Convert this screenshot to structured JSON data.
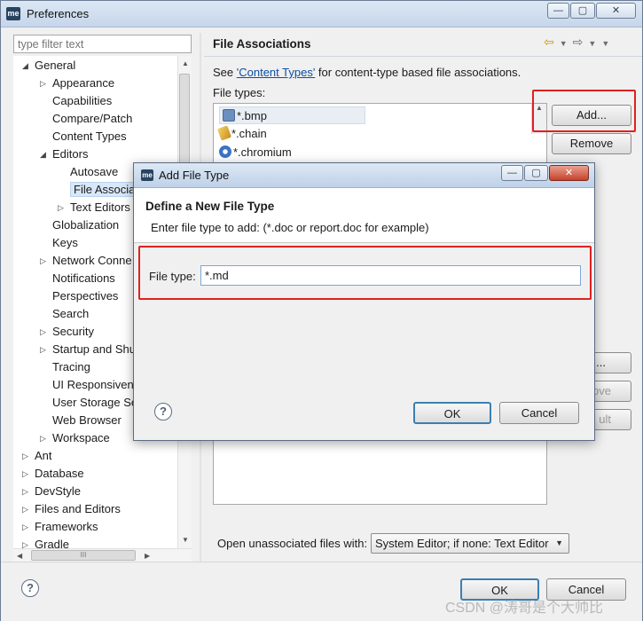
{
  "window": {
    "title": "Preferences",
    "app_icon": "me",
    "controls": {
      "minimize": "—",
      "maximize": "▢",
      "close": "✕"
    }
  },
  "sidebar": {
    "filter_placeholder": "type filter text",
    "tree": [
      {
        "label": "General",
        "level": 0,
        "expanded": true
      },
      {
        "label": "Appearance",
        "level": 1,
        "collapsed": true
      },
      {
        "label": "Capabilities",
        "level": 1
      },
      {
        "label": "Compare/Patch",
        "level": 1
      },
      {
        "label": "Content Types",
        "level": 1
      },
      {
        "label": "Editors",
        "level": 1,
        "expanded": true
      },
      {
        "label": "Autosave",
        "level": 2
      },
      {
        "label": "File Associati",
        "level": 2,
        "selected": true
      },
      {
        "label": "Text Editors",
        "level": 2,
        "collapsed": true
      },
      {
        "label": "Globalization",
        "level": 1
      },
      {
        "label": "Keys",
        "level": 1
      },
      {
        "label": "Network Conne",
        "level": 1,
        "collapsed": true
      },
      {
        "label": "Notifications",
        "level": 1
      },
      {
        "label": "Perspectives",
        "level": 1
      },
      {
        "label": "Search",
        "level": 1
      },
      {
        "label": "Security",
        "level": 1,
        "collapsed": true
      },
      {
        "label": "Startup and Shu",
        "level": 1,
        "collapsed": true
      },
      {
        "label": "Tracing",
        "level": 1
      },
      {
        "label": "UI Responsivene",
        "level": 1
      },
      {
        "label": "User Storage Se",
        "level": 1
      },
      {
        "label": "Web Browser",
        "level": 1
      },
      {
        "label": "Workspace",
        "level": 1,
        "collapsed": true
      },
      {
        "label": "Ant",
        "level": 0,
        "collapsed": true
      },
      {
        "label": "Database",
        "level": 0,
        "collapsed": true
      },
      {
        "label": "DevStyle",
        "level": 0,
        "collapsed": true
      },
      {
        "label": "Files and Editors",
        "level": 0,
        "collapsed": true
      },
      {
        "label": "Frameworks",
        "level": 0,
        "collapsed": true
      },
      {
        "label": "Gradle",
        "level": 0,
        "collapsed": true
      }
    ],
    "hscroll_thumb": "III"
  },
  "main": {
    "title": "File Associations",
    "description_prefix": "See ",
    "description_link": "'Content Types'",
    "description_suffix": " for content-type based file associations.",
    "file_types_label": "File types:",
    "file_types": [
      {
        "name": "*.bmp",
        "icon": "image-file-icon",
        "color": "#6a8fc0"
      },
      {
        "name": "*.chain",
        "icon": "pencil-file-icon",
        "color": "#d9a62a"
      },
      {
        "name": "*.chromium",
        "icon": "chromium-icon",
        "color": "#3d73c6"
      }
    ],
    "add_button": "Add...",
    "remove_button": "Remove",
    "hidden_buttons": {
      "add2": "...",
      "remove2": "ove",
      "default2": "ult"
    },
    "open_unassociated_label": "Open unassociated files with:",
    "open_unassociated_value": "System Editor; if none: Text Editor"
  },
  "dialog": {
    "title": "Add File Type",
    "heading": "Define a New File Type",
    "message": "Enter file type to add: (*.doc or report.doc for example)",
    "file_type_label": "File type:",
    "file_type_value": "*.md",
    "ok_button": "OK",
    "cancel_button": "Cancel"
  },
  "footer": {
    "ok_button": "OK",
    "cancel_button": "Cancel"
  },
  "help_icon": "?",
  "watermark": "CSDN @涛哥是个大帅比",
  "colors": {
    "highlight_red": "#e02020",
    "link_blue": "#0c4fa3",
    "selection": "#d9e8f8",
    "focused_button_border": "#3c7fb1"
  }
}
